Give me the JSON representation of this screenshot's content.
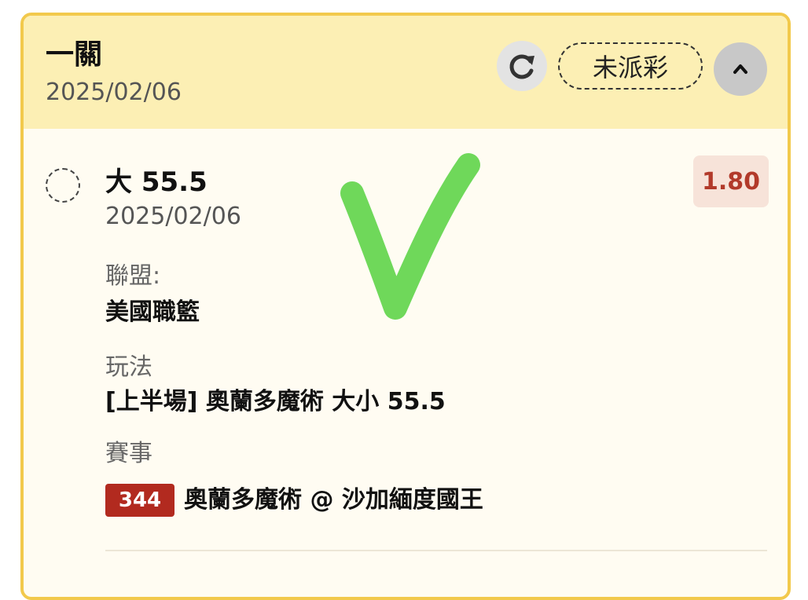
{
  "header": {
    "title": "一關",
    "date": "2025/02/06",
    "status_label": "未派彩"
  },
  "bet": {
    "selection": "大 55.5",
    "date": "2025/02/06",
    "odds": "1.80",
    "league_label": "聯盟:",
    "league_value": "美國職籃",
    "market_label": "玩法",
    "market_value": "[上半場] 奧蘭多魔術 大小 55.5",
    "event_label": "賽事",
    "event_number": "344",
    "event_value": "奧蘭多魔術 @ 沙加緬度國王"
  },
  "icons": {
    "refresh": "refresh-icon",
    "collapse": "chevron-up-icon",
    "radio": "radio-circle-icon",
    "overlay": "green-checkmark-icon"
  },
  "colors": {
    "card_border": "#f2c94c",
    "header_bg": "#fcefb4",
    "card_bg": "#fffcf2",
    "odds_text": "#b23a2a",
    "odds_bg": "#f7e3d9",
    "match_badge": "#b22a1f",
    "checkmark": "#6fd85a"
  }
}
